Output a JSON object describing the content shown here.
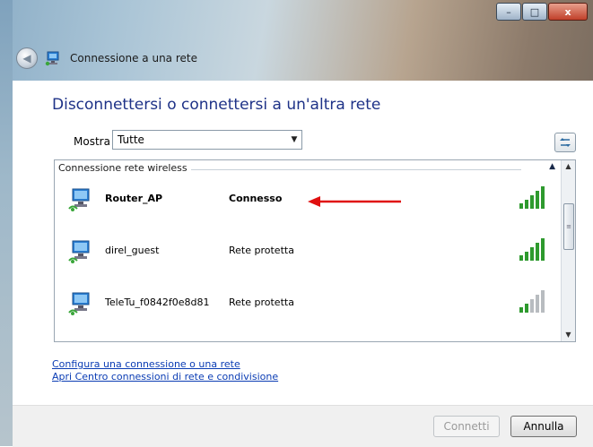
{
  "window": {
    "title": "Connessione a una rete",
    "controls": {
      "minimize": "–",
      "maximize": "□",
      "close": "x"
    }
  },
  "main": {
    "heading": "Disconnettersi o connettersi a un'altra rete",
    "filter_label": "Mostra",
    "filter_value": "Tutte"
  },
  "list": {
    "group_title": "Connessione rete wireless",
    "networks": [
      {
        "name": "Router_AP",
        "status": "Connesso",
        "signal_bars": 5,
        "connected": true
      },
      {
        "name": "direl_guest",
        "status": "Rete protetta",
        "signal_bars": 5,
        "connected": false
      },
      {
        "name": "TeleTu_f0842f0e8d81",
        "status": "Rete protetta",
        "signal_bars": 2,
        "connected": false
      }
    ]
  },
  "links": {
    "setup": "Configura una connessione o una rete",
    "network_center": "Apri Centro connessioni di rete e condivisione"
  },
  "buttons": {
    "connect": "Connetti",
    "cancel": "Annulla"
  },
  "colors": {
    "heading": "#1e3287",
    "link": "#0a3cb4",
    "annotation_arrow": "#e01010",
    "signal_active": "#2e9a2e",
    "signal_inactive": "#b8bcc0"
  },
  "icons": {
    "back": "back-arrow-icon",
    "network": "network-computer-icon",
    "refresh": "refresh-icon",
    "signal": "signal-strength-icon"
  }
}
